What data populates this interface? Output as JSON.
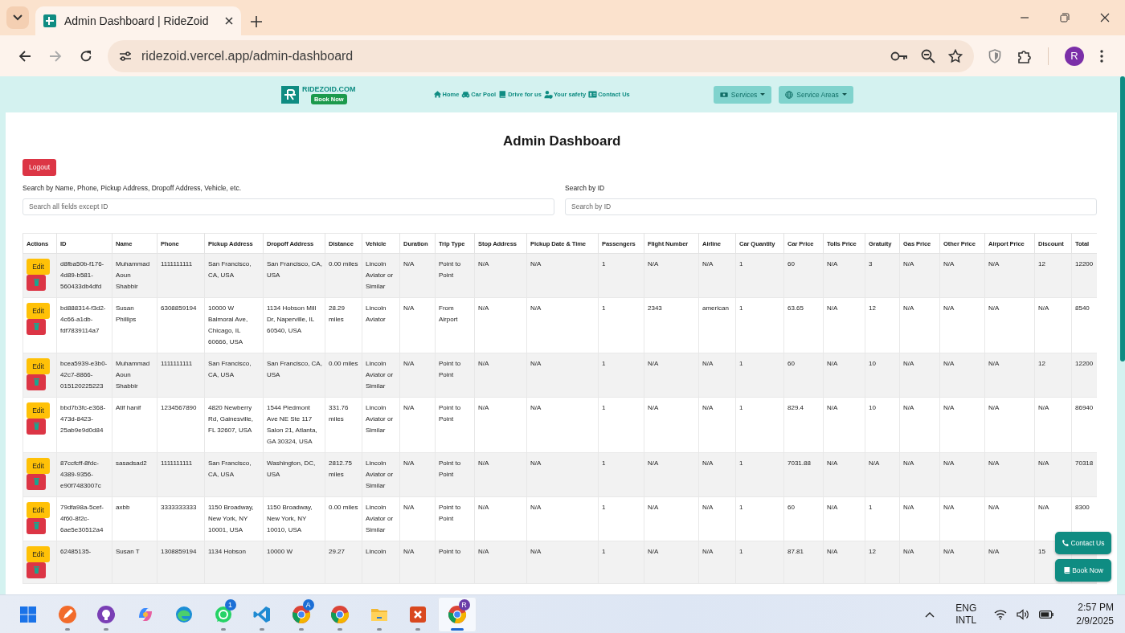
{
  "browser": {
    "tab": {
      "title": "Admin Dashboard | RideZoid",
      "selected": true
    },
    "url": "ridezoid.vercel.app/admin-dashboard",
    "profile": "R"
  },
  "navbar": {
    "brand": "RIDEZOID.COM",
    "brand_badge": "Book Now",
    "links": [
      {
        "label": "Home",
        "kind": "home"
      },
      {
        "label": "Car Pool",
        "kind": "car"
      },
      {
        "label": "Drive for us",
        "kind": "book"
      },
      {
        "label": "Your safety",
        "kind": "person"
      },
      {
        "label": "Contact Us",
        "kind": "card"
      }
    ],
    "dropdowns": [
      {
        "label": "Services",
        "kind": "money"
      },
      {
        "label": "Service Areas",
        "kind": "globe"
      }
    ]
  },
  "page": {
    "title": "Admin Dashboard",
    "logout": "Logout",
    "search": {
      "label": "Search by Name, Phone, Pickup Address, Dropoff Address, Vehicle, etc.",
      "placeholder": "Search all fields except ID"
    },
    "search_id": {
      "label": "Search by ID",
      "placeholder": "Search by ID"
    }
  },
  "table": {
    "actions_header": "Actions",
    "columns": [
      "ID",
      "Name",
      "Phone",
      "Pickup Address",
      "Dropoff Address",
      "Distance",
      "Vehicle",
      "Duration",
      "Trip Type",
      "Stop Address",
      "Pickup Date & Time",
      "Passengers",
      "Flight Number",
      "Airline",
      "Car Quantity",
      "Car Price",
      "Tolls Price",
      "Gratuity",
      "Gas Price",
      "Other Price",
      "Airport Price",
      "Discount",
      "Total"
    ],
    "rows": [
      {
        "edit": "Edit",
        "cells": [
          "d8fba50b-f176-4d89-b581-560433db4dfd",
          "Muhammad Aoun Shabbir",
          "1111111111",
          "San Francisco, CA, USA",
          "San Francisco, CA, USA",
          "0.00 miles",
          "Lincoln Aviator or Similar",
          "N/A",
          "Point to Point",
          "N/A",
          "N/A",
          "1",
          "N/A",
          "N/A",
          "1",
          "60",
          "N/A",
          "3",
          "N/A",
          "N/A",
          "N/A",
          "12",
          "12200"
        ]
      },
      {
        "edit": "Edit",
        "cells": [
          "bd888314-f3d2-4c66-a1db-fdf7839114a7",
          "Susan Phillips",
          "6308859194",
          "10000 W Balmoral Ave, Chicago, IL 60666, USA",
          "1134 Hobson Mill Dr, Naperville, IL 60540, USA",
          "28.29 miles",
          "Lincoln Aviator",
          "N/A",
          "From Airport",
          "N/A",
          "N/A",
          "1",
          "2343",
          "american",
          "1",
          "63.65",
          "N/A",
          "12",
          "N/A",
          "N/A",
          "N/A",
          "N/A",
          "8540"
        ]
      },
      {
        "edit": "Edit",
        "cells": [
          "bcea5939-e3b0-42c7-8866-015120225223",
          "Muhammad Aoun Shabbir",
          "1111111111",
          "San Francisco, CA, USA",
          "San Francisco, CA, USA",
          "0.00 miles",
          "Lincoln Aviator or Similar",
          "N/A",
          "Point to Point",
          "N/A",
          "N/A",
          "1",
          "N/A",
          "N/A",
          "1",
          "60",
          "N/A",
          "10",
          "N/A",
          "N/A",
          "N/A",
          "12",
          "12200"
        ]
      },
      {
        "edit": "Edit",
        "cells": [
          "bbd7b3fc-e368-473d-8423-25ab9e9d0d84",
          "Atif hanif",
          "1234567890",
          "4820 Newberry Rd, Gainesville, FL 32607, USA",
          "1544 Piedmont Ave NE Ste 117 Salon 21, Atlanta, GA 30324, USA",
          "331.76 miles",
          "Lincoln Aviator or Similar",
          "N/A",
          "Point to Point",
          "N/A",
          "N/A",
          "1",
          "N/A",
          "N/A",
          "1",
          "829.4",
          "N/A",
          "10",
          "N/A",
          "N/A",
          "N/A",
          "N/A",
          "86940"
        ]
      },
      {
        "edit": "Edit",
        "cells": [
          "87ccfcff-8fdc-4389-9356-e90f7483007c",
          "sasadsad2",
          "1111111111",
          "San Francisco, CA, USA",
          "Washington, DC, USA",
          "2812.75 miles",
          "Lincoln Aviator or Similar",
          "N/A",
          "Point to Point",
          "N/A",
          "N/A",
          "1",
          "N/A",
          "N/A",
          "1",
          "7031.88",
          "N/A",
          "N/A",
          "N/A",
          "N/A",
          "N/A",
          "N/A",
          "70318"
        ]
      },
      {
        "edit": "Edit",
        "cells": [
          "79dfa98a-5cef-4f60-8f2c-6ae5e30512a4",
          "axbb",
          "3333333333",
          "1150 Broadway, New York, NY 10001, USA",
          "1150 Broadway, New York, NY 10010, USA",
          "0.00 miles",
          "Lincoln Aviator or Similar",
          "N/A",
          "Point to Point",
          "N/A",
          "N/A",
          "1",
          "N/A",
          "N/A",
          "1",
          "60",
          "N/A",
          "1",
          "N/A",
          "N/A",
          "N/A",
          "N/A",
          "8300"
        ]
      },
      {
        "edit": "Edit",
        "cells": [
          "62485135-",
          "Susan T",
          "1308859194",
          "1134 Hobson",
          "10000 W",
          "29.27",
          "Lincoln",
          "N/A",
          "Point to",
          "N/A",
          "N/A",
          "1",
          "N/A",
          "N/A",
          "1",
          "87.81",
          "N/A",
          "12",
          "N/A",
          "N/A",
          "N/A",
          "15"
        ]
      }
    ]
  },
  "floating_buttons": [
    {
      "label": "Contact Us",
      "kind": "phone"
    },
    {
      "label": "Book Now",
      "kind": "book"
    }
  ],
  "taskbar": {
    "apps": [
      {
        "kind": "start",
        "running": false,
        "selected": false
      },
      {
        "kind": "pen",
        "running": true,
        "selected": false
      },
      {
        "kind": "github",
        "running": true,
        "selected": false
      },
      {
        "kind": "copilot",
        "running": false,
        "selected": false
      },
      {
        "kind": "edge",
        "running": false,
        "selected": false
      },
      {
        "kind": "whatsapp",
        "running": true,
        "selected": false,
        "badge": "1"
      },
      {
        "kind": "vscode",
        "running": true,
        "selected": false
      },
      {
        "kind": "chrome",
        "running": true,
        "selected": false,
        "badge": "A"
      },
      {
        "kind": "chrome",
        "running": true,
        "selected": false
      },
      {
        "kind": "folder",
        "running": true,
        "selected": false
      },
      {
        "kind": "remote",
        "running": true,
        "selected": false
      },
      {
        "kind": "chrome",
        "running": true,
        "selected": true,
        "badge": "R"
      }
    ],
    "language": "ENG",
    "layout": "INTL",
    "time": "2:57 PM",
    "date": "2/9/2025"
  }
}
